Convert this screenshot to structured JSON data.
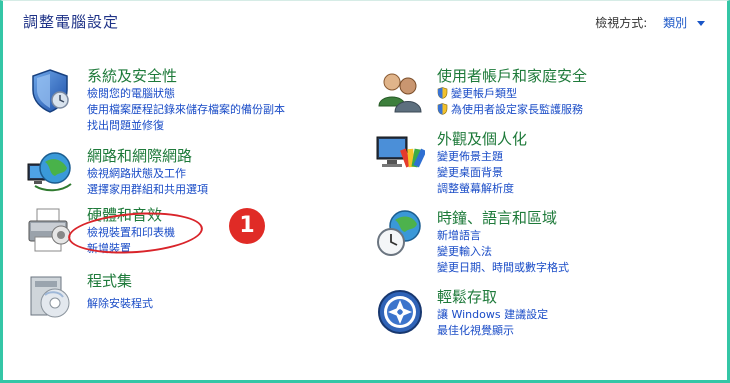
{
  "header": {
    "title": "調整電腦設定",
    "view_mode_label": "檢視方式:",
    "view_mode_value": "類別"
  },
  "categories_left": [
    {
      "title": "系統及安全性",
      "icon": "shield-icon",
      "links": [
        "檢閱您的電腦狀態",
        "使用檔案歷程記錄來儲存檔案的備份副本",
        "找出問題並修復"
      ]
    },
    {
      "title": "網路和網際網路",
      "icon": "network-globe-icon",
      "links": [
        "檢視網路狀態及工作",
        "選擇家用群組和共用選項"
      ]
    },
    {
      "title": "硬體和音效",
      "icon": "printer-icon",
      "links": [
        "檢視裝置和印表機",
        "新增裝置"
      ]
    },
    {
      "title": "程式集",
      "icon": "programs-disc-icon",
      "links": [
        "解除安裝程式"
      ]
    }
  ],
  "categories_right": [
    {
      "title": "使用者帳戶和家庭安全",
      "icon": "users-icon",
      "links": [
        "變更帳戶類型",
        "為使用者設定家長監護服務"
      ]
    },
    {
      "title": "外觀及個人化",
      "icon": "display-palette-icon",
      "links": [
        "變更佈景主題",
        "變更桌面背景",
        "調整螢幕解析度"
      ]
    },
    {
      "title": "時鐘、語言和區域",
      "icon": "clock-globe-icon",
      "links": [
        "新增語言",
        "變更輸入法",
        "變更日期、時間或數字格式"
      ]
    },
    {
      "title": "輕鬆存取",
      "icon": "ease-of-access-icon",
      "links": [
        "讓 Windows 建議設定",
        "最佳化視覺顯示"
      ]
    }
  ],
  "annotation": {
    "badge": "1"
  },
  "colors": {
    "title_blue": "#1e3287",
    "category_green": "#1e7a3a",
    "link_blue": "#1a4cc7",
    "frame": "#34c6a6",
    "annotation_red": "#e02b26"
  }
}
